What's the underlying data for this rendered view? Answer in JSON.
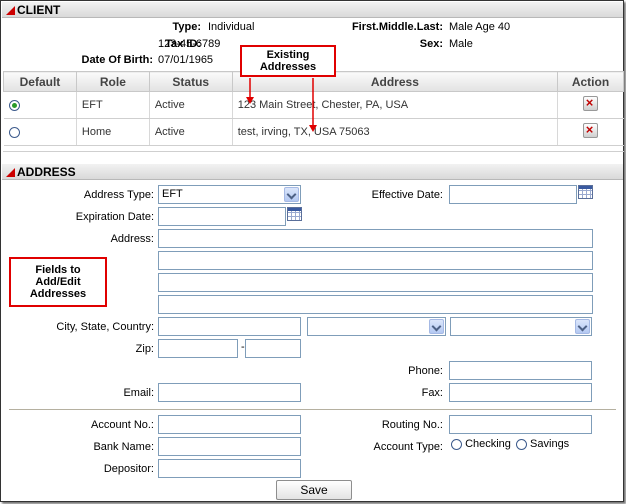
{
  "client": {
    "section_title": "CLIENT",
    "type_label": "Type:",
    "type_value": "Individual",
    "tax_id_label": "Tax ID:",
    "tax_id_value": "123-45-6789",
    "dob_label": "Date Of Birth:",
    "dob_value": "07/01/1965",
    "name_label": "First.Middle.Last:",
    "name_value": "Male Age 40",
    "sex_label": "Sex:",
    "sex_value": "Male"
  },
  "address_table": {
    "headers": [
      "Default",
      "Role",
      "Status",
      "Address",
      "Action"
    ],
    "rows": [
      {
        "default": true,
        "role": "EFT",
        "status": "Active",
        "address": "123 Main Street, Chester, PA, USA"
      },
      {
        "default": false,
        "role": "Home",
        "status": "Active",
        "address": "test, irving, TX, USA 75063"
      }
    ]
  },
  "callouts": {
    "existing": "Existing Addresses",
    "fields": "Fields to Add/Edit Addresses"
  },
  "address_form": {
    "section_title": "ADDRESS",
    "address_type_label": "Address Type:",
    "address_type_value": "EFT",
    "effective_date_label": "Effective Date:",
    "expiration_date_label": "Expiration Date:",
    "address_label": "Address:",
    "city_state_country_label": "City, State, Country:",
    "zip_label": "Zip:",
    "zip_sep": "-",
    "phone_label": "Phone:",
    "email_label": "Email:",
    "fax_label": "Fax:",
    "account_no_label": "Account No.:",
    "routing_no_label": "Routing No.:",
    "bank_name_label": "Bank Name:",
    "account_type_label": "Account Type:",
    "account_type_options": [
      "Checking",
      "Savings"
    ],
    "depositor_label": "Depositor:",
    "save_label": "Save"
  },
  "colors": {
    "accent": "#cc0000",
    "input_border": "#7f9db9"
  }
}
